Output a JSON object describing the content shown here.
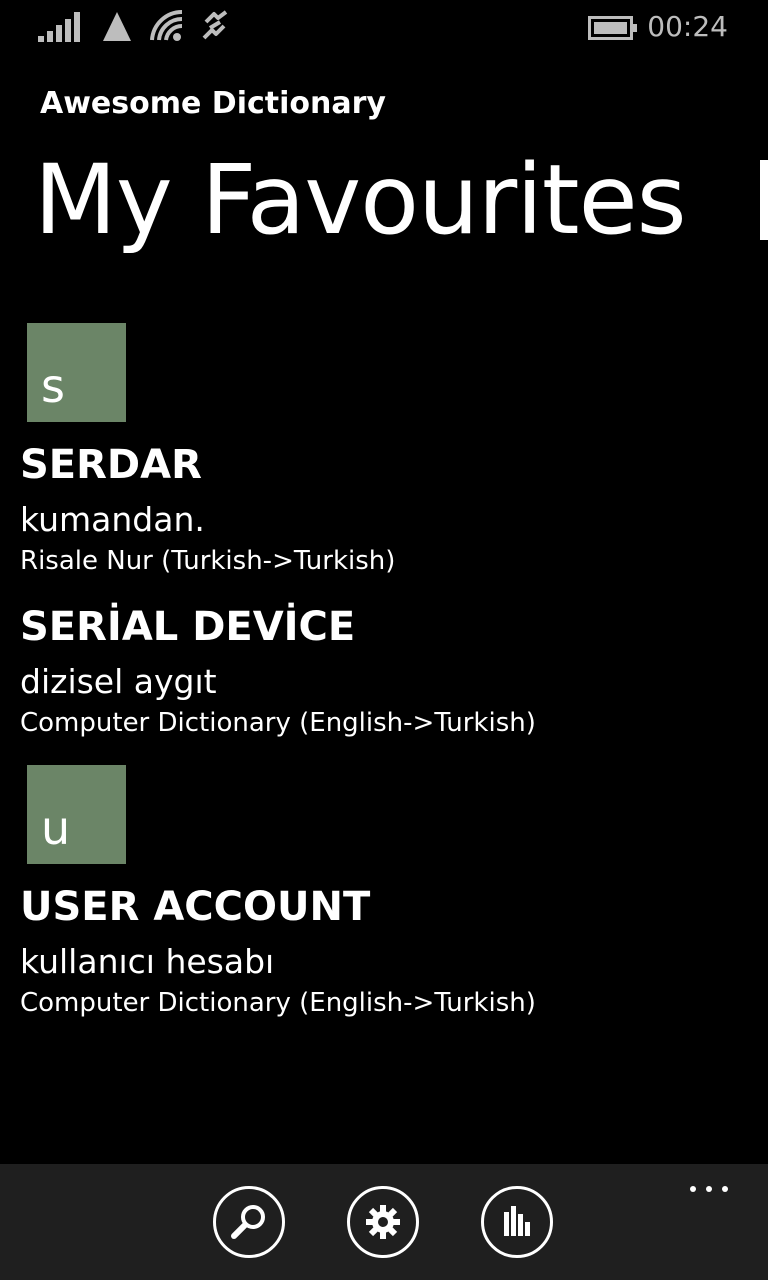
{
  "status_bar": {
    "time": "00:24",
    "icons": [
      "signal-bars-icon",
      "network-triangle-icon",
      "wifi-icon",
      "data-sync-icon",
      "battery-icon"
    ]
  },
  "app": {
    "title": "Awesome Dictionary",
    "page_title": "My Favourites"
  },
  "groups": [
    {
      "letter": "s",
      "entries": [
        {
          "word": "SERDAR",
          "meaning": "kumandan.",
          "source": "Risale Nur (Turkish->Turkish)"
        },
        {
          "word": "SERİAL DEVİCE",
          "meaning": "dizisel aygıt",
          "source": "Computer Dictionary (English->Turkish)"
        }
      ]
    },
    {
      "letter": "u",
      "entries": [
        {
          "word": "USER ACCOUNT",
          "meaning": "kullanıcı hesabı",
          "source": "Computer Dictionary (English->Turkish)"
        }
      ]
    }
  ],
  "app_bar": {
    "buttons": [
      "search-icon",
      "gear-icon",
      "chart-icon"
    ],
    "more": "more-icon"
  },
  "colors": {
    "background": "#000000",
    "accent_tile": "#6b8567",
    "app_bar": "#1f1f1f"
  }
}
